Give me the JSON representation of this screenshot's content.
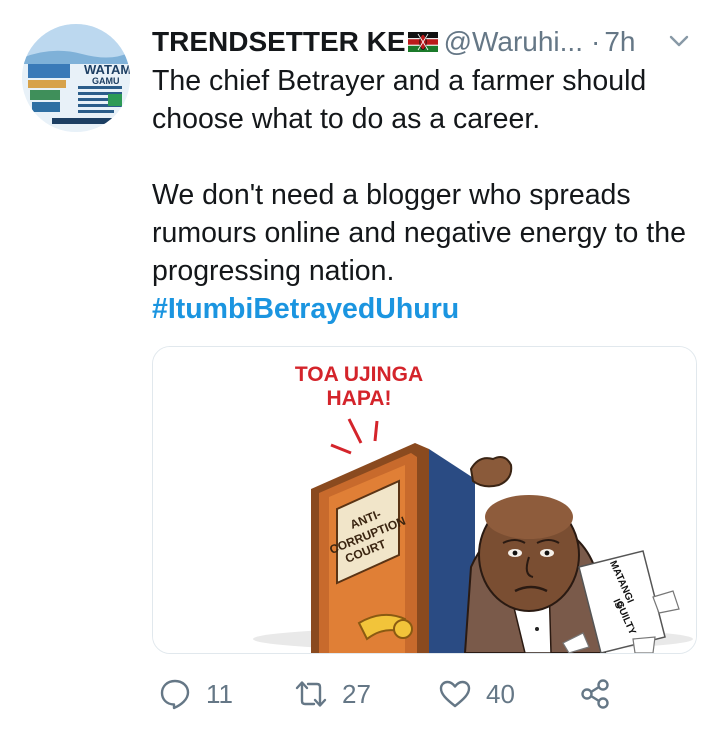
{
  "tweet": {
    "display_name": "TRENDSETTER KE",
    "handle": "@Waruhi...",
    "separator": "·",
    "time": "7h",
    "text_line1": "The chief Betrayer and a farmer should choose what to do as a career.",
    "text_line2": "We don't need a blogger who spreads rumours online and negative energy to the progressing nation.",
    "hashtag": "#ItumbiBetrayedUhuru",
    "flag_icon": "kenya-flag-emoji",
    "avatar_text_top": "WATAMU",
    "avatar_text_bottom": "GAMU"
  },
  "media": {
    "caption_line1": "TOA UJINGA",
    "caption_line2": "HAPA!",
    "door_sign_line1": "ANTI-",
    "door_sign_line2": "CORRUPTION",
    "door_sign_line3": "COURT",
    "paper_line1": "MATANGI",
    "paper_line2": "IS",
    "paper_line3": "GUILTY"
  },
  "actions": {
    "replies": "11",
    "retweets": "27",
    "likes": "40"
  },
  "colors": {
    "text": "#14171a",
    "secondary": "#657786",
    "link": "#1b95e0",
    "border": "#e1e8ed"
  }
}
